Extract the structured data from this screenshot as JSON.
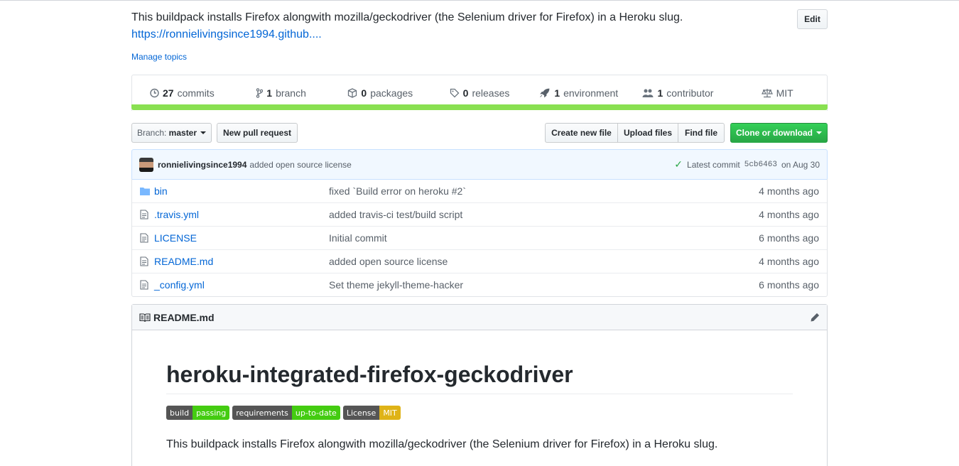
{
  "repo": {
    "description": "This buildpack installs Firefox alongwith mozilla/geckodriver (the Selenium driver for Firefox) in a Heroku slug.",
    "homepage": "https://ronnielivingsince1994.github....",
    "manage_topics": "Manage topics",
    "edit_label": "Edit"
  },
  "summary": {
    "commits": {
      "count": "27",
      "label": "commits",
      "icon": "history-icon"
    },
    "branch": {
      "count": "1",
      "label": "branch",
      "icon": "branch-icon"
    },
    "packages": {
      "count": "0",
      "label": "packages",
      "icon": "package-icon"
    },
    "releases": {
      "count": "0",
      "label": "releases",
      "icon": "tag-icon"
    },
    "environment": {
      "count": "1",
      "label": "environment",
      "icon": "rocket-icon"
    },
    "contributor": {
      "count": "1",
      "label": "contributor",
      "icon": "people-icon"
    },
    "license": {
      "label": "MIT",
      "icon": "law-icon"
    },
    "language_bar_color": "#89e051"
  },
  "toolbar": {
    "branch_prefix": "Branch:",
    "branch_name": "master",
    "new_pull_request": "New pull request",
    "create_new_file": "Create new file",
    "upload_files": "Upload files",
    "find_file": "Find file",
    "clone_or_download": "Clone or download"
  },
  "latest_commit": {
    "author": "ronnielivingsince1994",
    "message": "added open source license",
    "prefix": "Latest commit",
    "sha": "5cb6463",
    "date": "on Aug 30"
  },
  "files": [
    {
      "name": "bin",
      "type": "folder",
      "message": "fixed `Build error on heroku #2`",
      "age": "4 months ago"
    },
    {
      "name": ".travis.yml",
      "type": "file",
      "message": "added travis-ci test/build script",
      "age": "4 months ago"
    },
    {
      "name": "LICENSE",
      "type": "file",
      "message": "Initial commit",
      "age": "6 months ago"
    },
    {
      "name": "README.md",
      "type": "file",
      "message": "added open source license",
      "age": "4 months ago"
    },
    {
      "name": "_config.yml",
      "type": "file",
      "message": "Set theme jekyll-theme-hacker",
      "age": "6 months ago"
    }
  ],
  "readme": {
    "filename": "README.md",
    "title": "heroku-integrated-firefox-geckodriver",
    "badges": [
      {
        "left": "build",
        "right": "passing",
        "color": "#4c1"
      },
      {
        "left": "requirements",
        "right": "up-to-date",
        "color": "#4c1"
      },
      {
        "left": "License",
        "right": "MIT",
        "color": "#dfb317"
      }
    ],
    "body": "This buildpack installs Firefox alongwith mozilla/geckodriver (the Selenium driver for Firefox) in a Heroku slug."
  }
}
